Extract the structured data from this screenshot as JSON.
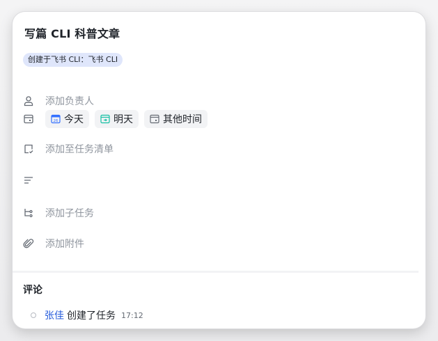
{
  "task": {
    "title": "写篇 CLI 科普文章",
    "source_tag": "创建于飞书 CLI：飞书 CLI"
  },
  "fields": {
    "assignee_placeholder": "添加负责人",
    "due_options": [
      {
        "label": "今天",
        "icon": "calendar-today-icon",
        "color": "#3370ff"
      },
      {
        "label": "明天",
        "icon": "calendar-tomorrow-icon",
        "color": "#14c0a4"
      },
      {
        "label": "其他时间",
        "icon": "calendar-other-icon",
        "color": "#646a73"
      }
    ],
    "tasklist_placeholder": "添加至任务清单",
    "subtask_placeholder": "添加子任务",
    "attachment_placeholder": "添加附件"
  },
  "comments": {
    "title": "评论",
    "activity": [
      {
        "user": "张佳",
        "action": "创建了任务",
        "time": "17:12"
      }
    ]
  },
  "colors": {
    "tag_bg": "#dfe6fb",
    "link": "#245bdb",
    "placeholder": "#8f959e"
  }
}
